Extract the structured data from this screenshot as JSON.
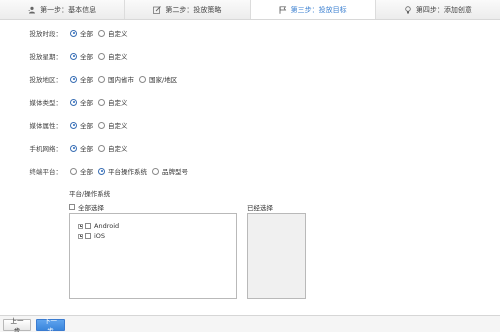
{
  "steps": [
    {
      "label": "第一步：基本信息",
      "icon": "person-icon",
      "active": false
    },
    {
      "label": "第二步：投放策略",
      "icon": "edit-icon",
      "active": false
    },
    {
      "label": "第三步：投放目标",
      "icon": "flag-icon",
      "active": true
    },
    {
      "label": "第四步：添加创意",
      "icon": "lightbulb-icon",
      "active": false
    }
  ],
  "rows": [
    {
      "label": "投放时段：",
      "options": [
        "全部",
        "自定义"
      ],
      "selected": 0
    },
    {
      "label": "投放星期：",
      "options": [
        "全部",
        "自定义"
      ],
      "selected": 0
    },
    {
      "label": "投放地区：",
      "options": [
        "全部",
        "国内省市",
        "国家/地区"
      ],
      "selected": 0
    },
    {
      "label": "媒体类型：",
      "options": [
        "全部",
        "自定义"
      ],
      "selected": 0
    },
    {
      "label": "媒体属性：",
      "options": [
        "全部",
        "自定义"
      ],
      "selected": 0
    },
    {
      "label": "手机网络：",
      "options": [
        "全部",
        "自定义"
      ],
      "selected": 0
    },
    {
      "label": "终端平台：",
      "options": [
        "全部",
        "平台操作系统",
        "品牌型号"
      ],
      "selected": 1
    }
  ],
  "platform": {
    "title": "平台/操作系统",
    "select_all": "全部选择",
    "items": [
      "Android",
      "iOS"
    ],
    "selected_title": "已经选择"
  },
  "buttons": {
    "prev": "上一步",
    "next": "下一步"
  },
  "colors": {
    "accent": "#3a86dc",
    "active_tab_text": "#3a7fd0"
  }
}
